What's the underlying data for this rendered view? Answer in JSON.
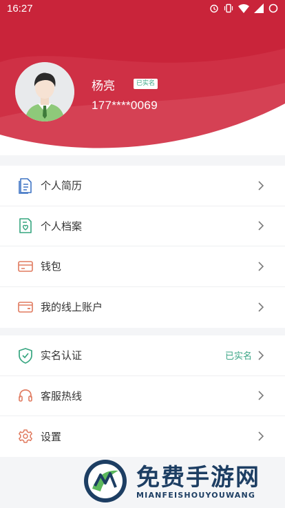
{
  "statusbar": {
    "time": "16:27",
    "icons": [
      "alarm-icon",
      "vibrate-icon",
      "wifi-icon",
      "signal-icon",
      "battery-icon"
    ]
  },
  "profile": {
    "name": "杨亮",
    "verified_badge": "已实名",
    "phone": "177****0069"
  },
  "menu_group_1": [
    {
      "label": "个人简历",
      "icon": "resume-icon"
    },
    {
      "label": "个人档案",
      "icon": "archive-icon"
    },
    {
      "label": "钱包",
      "icon": "wallet-icon"
    },
    {
      "label": "我的线上账户",
      "icon": "online-account-icon"
    }
  ],
  "menu_group_2": [
    {
      "label": "实名认证",
      "icon": "shield-check-icon",
      "status": "已实名"
    },
    {
      "label": "客服热线",
      "icon": "headset-icon"
    },
    {
      "label": "设置",
      "icon": "gear-icon"
    }
  ],
  "watermark": {
    "title": "免费手游网",
    "subtitle": "MIANFEISHOUYOUWANG"
  },
  "colors": {
    "header_red": "#c9243a",
    "verified_green": "#3aa585",
    "icon_blue": "#3f74c4",
    "icon_green": "#35a57f",
    "icon_orange": "#e07a5f",
    "watermark_navy": "#1d3e63"
  }
}
